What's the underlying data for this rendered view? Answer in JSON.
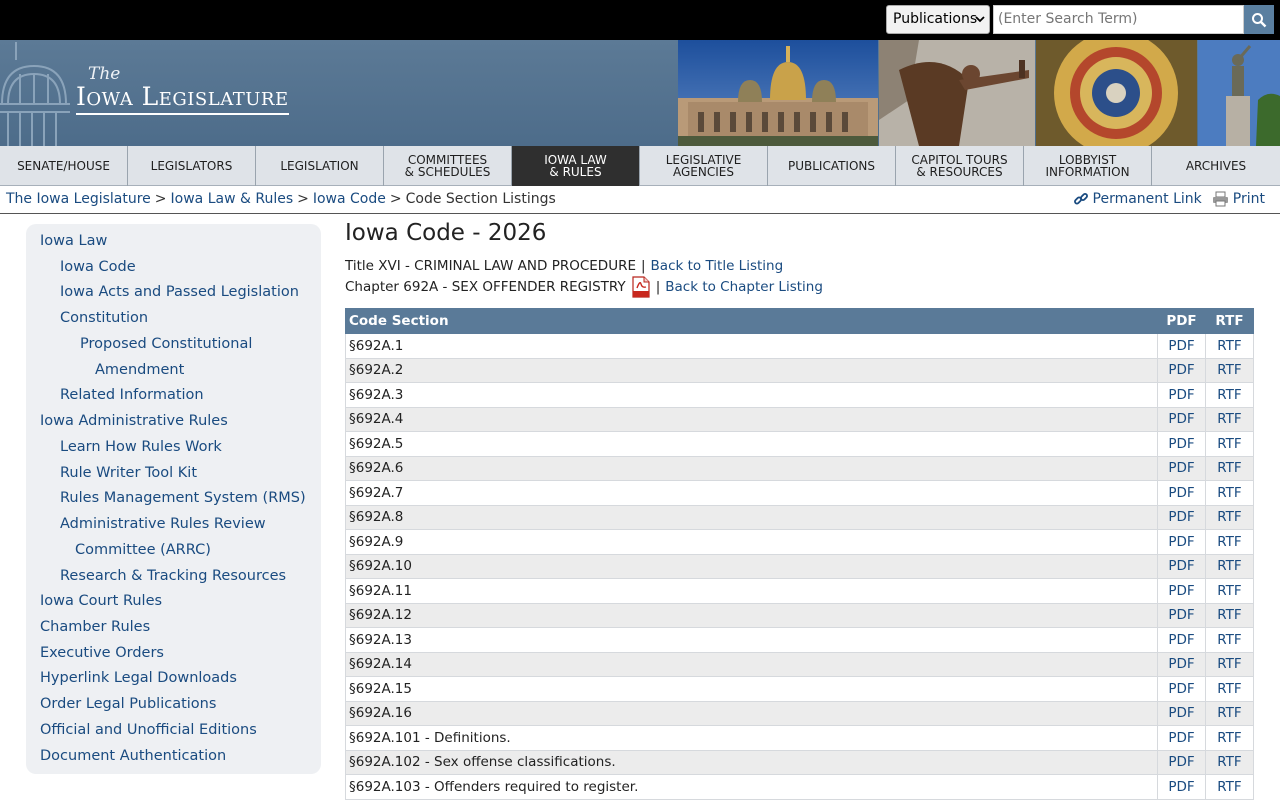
{
  "search": {
    "scope": "Publications",
    "placeholder": "(Enter Search Term)"
  },
  "logo": {
    "the": "The",
    "name": "Iowa Legislature"
  },
  "nav": [
    "SENATE/HOUSE",
    "LEGISLATORS",
    "LEGISLATION",
    "COMMITTEES\n& SCHEDULES",
    "IOWA LAW\n& RULES",
    "LEGISLATIVE\nAGENCIES",
    "PUBLICATIONS",
    "CAPITOL TOURS\n& RESOURCES",
    "LOBBYIST\nINFORMATION",
    "ARCHIVES"
  ],
  "nav_active": "IOWA LAW\n& RULES",
  "breadcrumb": {
    "items": [
      "The Iowa Legislature",
      "Iowa Law & Rules",
      "Iowa Code"
    ],
    "current": "Code Section Listings",
    "sep": ">"
  },
  "util": {
    "permalink": "Permanent Link",
    "print": "Print"
  },
  "sidebar": {
    "iowa_law": "Iowa Law",
    "iowa_code": "Iowa Code",
    "acts": "Iowa Acts and Passed Legislation",
    "constitution": "Constitution",
    "proposed_1": "Proposed Constitutional",
    "proposed_2": "Amendment",
    "related": "Related Information",
    "admin_rules": "Iowa Administrative Rules",
    "learn": "Learn How Rules Work",
    "toolkit": "Rule Writer Tool Kit",
    "rms": "Rules Management System (RMS)",
    "arrc_1": "Administrative Rules Review",
    "arrc_2": "Committee (ARRC)",
    "research": "Research & Tracking Resources",
    "court": "Iowa Court Rules",
    "chamber": "Chamber Rules",
    "exec": "Executive Orders",
    "hyperlink": "Hyperlink Legal Downloads",
    "order": "Order Legal Publications",
    "editions": "Official and Unofficial Editions",
    "auth": "Document Authentication"
  },
  "main": {
    "title": "Iowa Code - 2026",
    "title_line": "Title XVI - CRIMINAL LAW AND PROCEDURE",
    "back_title": "Back to Title Listing",
    "chapter_line": "Chapter 692A - SEX OFFENDER REGISTRY",
    "back_chapter": "Back to Chapter Listing",
    "pipe": "|"
  },
  "table": {
    "headers": {
      "section": "Code Section",
      "pdf": "PDF",
      "rtf": "RTF"
    },
    "rows": [
      "§692A.1",
      "§692A.2",
      "§692A.3",
      "§692A.4",
      "§692A.5",
      "§692A.6",
      "§692A.7",
      "§692A.8",
      "§692A.9",
      "§692A.10",
      "§692A.11",
      "§692A.12",
      "§692A.13",
      "§692A.14",
      "§692A.15",
      "§692A.16",
      "§692A.101 - Definitions.",
      "§692A.102 - Sex offense classifications.",
      "§692A.103 - Offenders required to register."
    ],
    "link_pdf": "PDF",
    "link_rtf": "RTF"
  },
  "colors": {
    "header_blue": "#5a7a98",
    "link": "#1a4b80",
    "banner": "#5c7a96",
    "nav_active": "#2f2f2f"
  },
  "icons": [
    "search-icon",
    "chevron-down-icon",
    "link-icon",
    "printer-icon",
    "pdf-icon",
    "capitol-dome-icon"
  ]
}
